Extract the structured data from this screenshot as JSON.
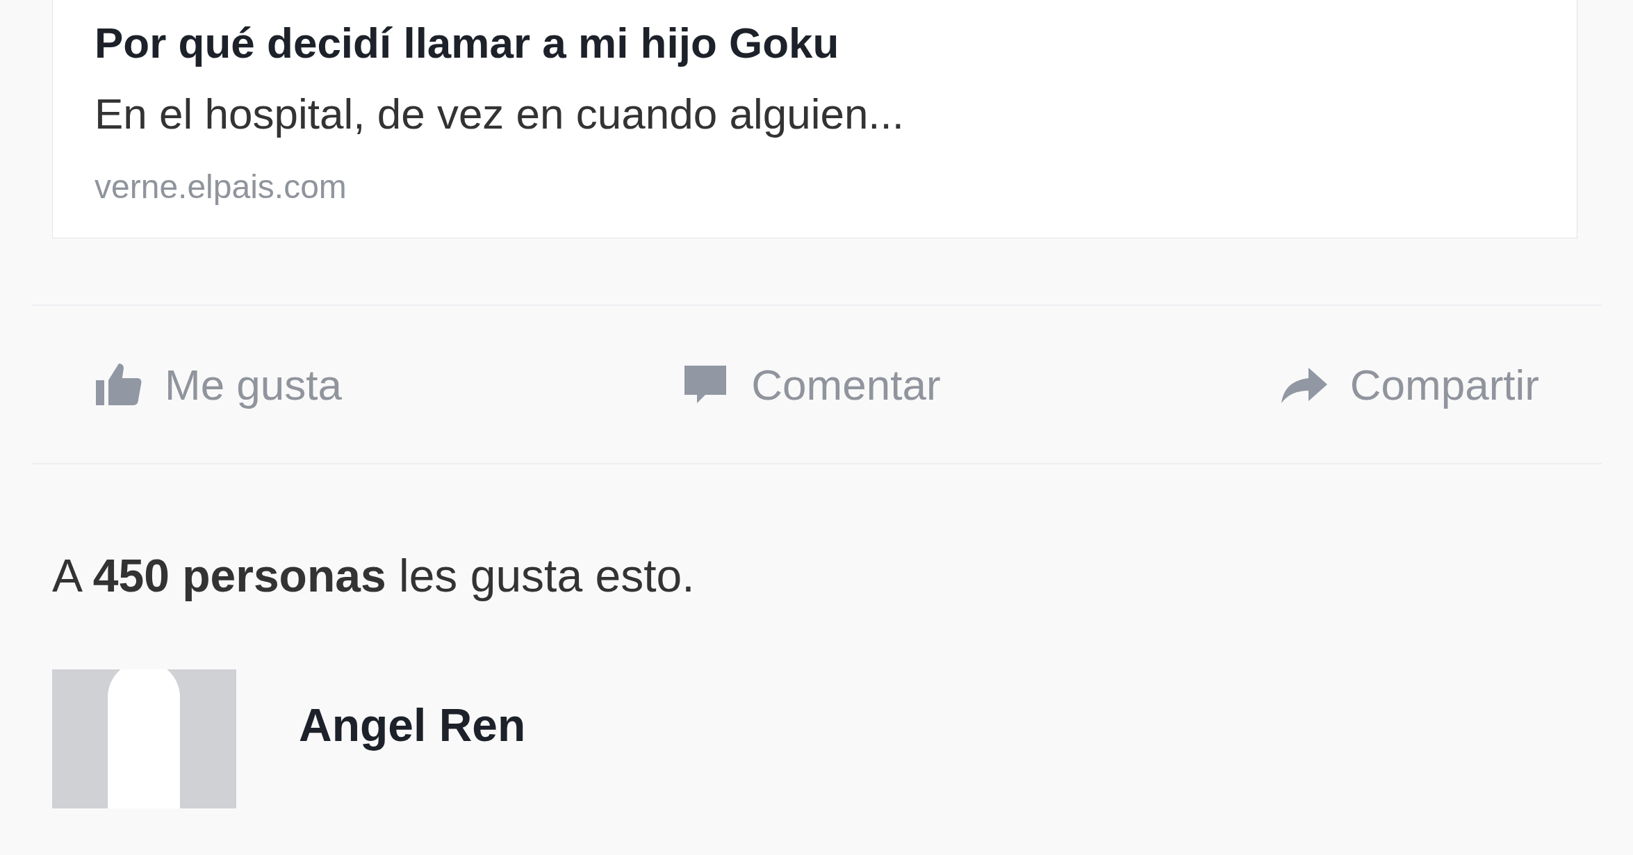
{
  "link_preview": {
    "title": "Por qué decidí llamar a mi hijo Goku",
    "description": "En el hospital, de vez en cuando alguien...",
    "domain": "verne.elpais.com"
  },
  "actions": [
    {
      "kind": "like",
      "label": "Me gusta"
    },
    {
      "kind": "comment",
      "label": "Comentar"
    },
    {
      "kind": "share",
      "label": "Compartir"
    }
  ],
  "likes_summary": "A **450 personas** les gusta esto.",
  "comment": {
    "author": "Angel Ren"
  }
}
